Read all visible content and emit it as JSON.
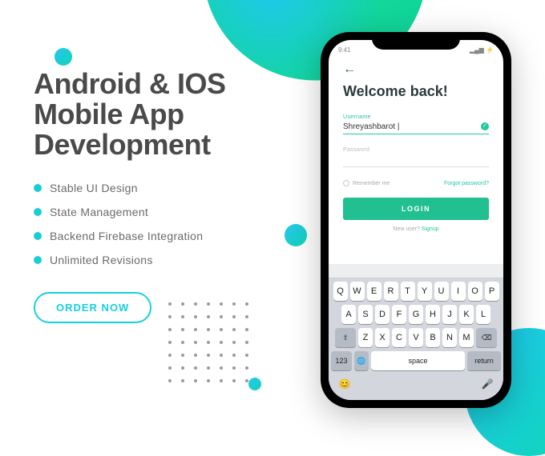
{
  "heading": "Android & IOS Mobile App Development",
  "features": [
    "Stable UI Design",
    "State Management",
    "Backend Firebase Integration",
    "Unlimited Revisions"
  ],
  "cta": "ORDER NOW",
  "phone": {
    "statusbar_time": "9:41",
    "back_glyph": "←",
    "welcome": "Welcome back!",
    "username_label": "Username",
    "username_value": "Shreyashbarot |",
    "password_label": "Password",
    "password_value": "",
    "remember": "Remember me",
    "forgot": "Forgot password?",
    "login": "LOGIN",
    "newuser": "New user?",
    "signup": "Signup",
    "keyboard": {
      "row1": [
        "Q",
        "W",
        "E",
        "R",
        "T",
        "Y",
        "U",
        "I",
        "O",
        "P"
      ],
      "row2": [
        "A",
        "S",
        "D",
        "F",
        "G",
        "H",
        "J",
        "K",
        "L"
      ],
      "row3": [
        "Z",
        "X",
        "C",
        "V",
        "B",
        "N",
        "M"
      ],
      "shift": "⇧",
      "del": "⌫",
      "num": "123",
      "globe": "🌐",
      "space": "space",
      "ret": "return",
      "emoji": "😊",
      "mic": "🎤"
    }
  }
}
